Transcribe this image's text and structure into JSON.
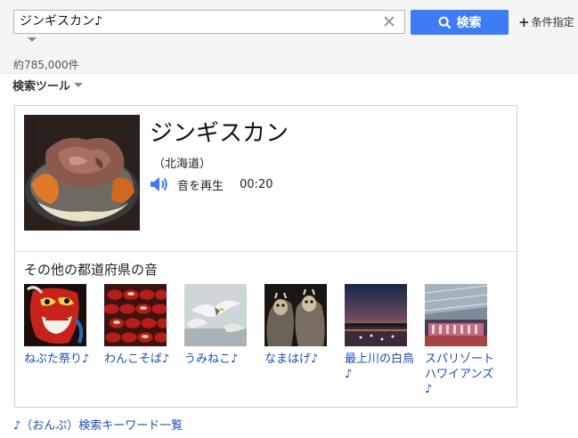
{
  "search": {
    "query": "ジンギスカン♪",
    "button_label": "検索",
    "conditions_label": "条件指定"
  },
  "results": {
    "count_text": "約785,000件",
    "tools_label": "検索ツール"
  },
  "card": {
    "title": "ジンギスカン",
    "region": "（北海道）",
    "play_label": "音を再生",
    "duration": "00:20",
    "others_title": "その他の都道府県の音",
    "items": [
      {
        "label": "ねぶた祭り♪"
      },
      {
        "label": "わんこそば♪"
      },
      {
        "label": "うみねこ♪"
      },
      {
        "label": "なまはげ♪"
      },
      {
        "label": "最上川の白鳥♪"
      },
      {
        "label": "スパリゾートハワイアンズ♪"
      }
    ]
  },
  "footer": {
    "link_label": "♪（おんぷ）検索キーワード一覧"
  },
  "colors": {
    "accent": "#3d7cf5",
    "link": "#1a4fb8"
  }
}
